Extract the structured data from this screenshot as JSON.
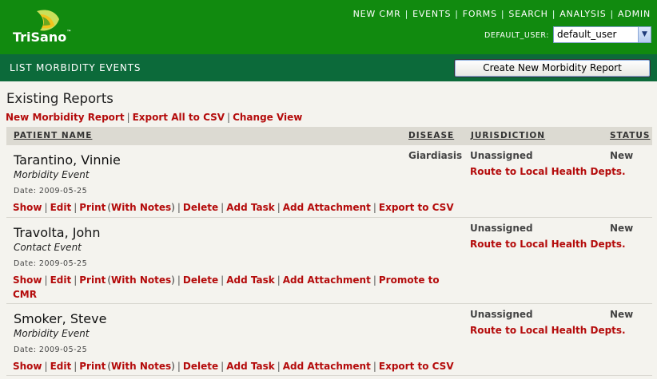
{
  "header": {
    "logo_text": "TriSano",
    "logo_tm": "™",
    "nav": [
      "NEW CMR",
      "EVENTS",
      "FORMS",
      "SEARCH",
      "ANALYSIS",
      "ADMIN"
    ],
    "user_label": "DEFAULT_USER:",
    "user_value": "default_user"
  },
  "subbar": {
    "title": "LIST MORBIDITY EVENTS",
    "create_button": "Create New Morbidity Report"
  },
  "main": {
    "title": "Existing Reports",
    "actions": [
      "New Morbidity Report",
      "Export All to CSV",
      "Change View"
    ]
  },
  "table": {
    "headers": [
      "PATIENT NAME",
      "DISEASE",
      "JURISDICTION",
      "STATUS"
    ],
    "rows": [
      {
        "name": "Tarantino, Vinnie",
        "type": "Morbidity Event",
        "date": "Date: 2009-05-25",
        "disease": "Giardiasis",
        "jurisdiction": "Unassigned",
        "route": "Route to Local Health Depts.",
        "status": "New",
        "links": [
          "Show",
          "Edit",
          "Print",
          "(",
          "With Notes",
          ")",
          "Delete",
          "Add Task",
          "Add Attachment",
          "Export to CSV"
        ]
      },
      {
        "name": "Travolta, John",
        "type": "Contact Event",
        "date": "Date: 2009-05-25",
        "disease": "",
        "jurisdiction": "Unassigned",
        "route": "Route to Local Health Depts.",
        "status": "New",
        "links": [
          "Show",
          "Edit",
          "Print",
          "(",
          "With Notes",
          ")",
          "Delete",
          "Add Task",
          "Add Attachment",
          "Promote to",
          "CMR"
        ]
      },
      {
        "name": "Smoker, Steve",
        "type": "Morbidity Event",
        "date": "Date: 2009-05-25",
        "disease": "",
        "jurisdiction": "Unassigned",
        "route": "Route to Local Health Depts.",
        "status": "New",
        "links": [
          "Show",
          "Edit",
          "Print",
          "(",
          "With Notes",
          ")",
          "Delete",
          "Add Task",
          "Add Attachment",
          "Export to CSV"
        ]
      }
    ]
  },
  "colors": {
    "header_green": "#118a0f",
    "subbar_green": "#0c6a3a",
    "link_red": "#b40b0b",
    "background": "#f4f3ee"
  }
}
